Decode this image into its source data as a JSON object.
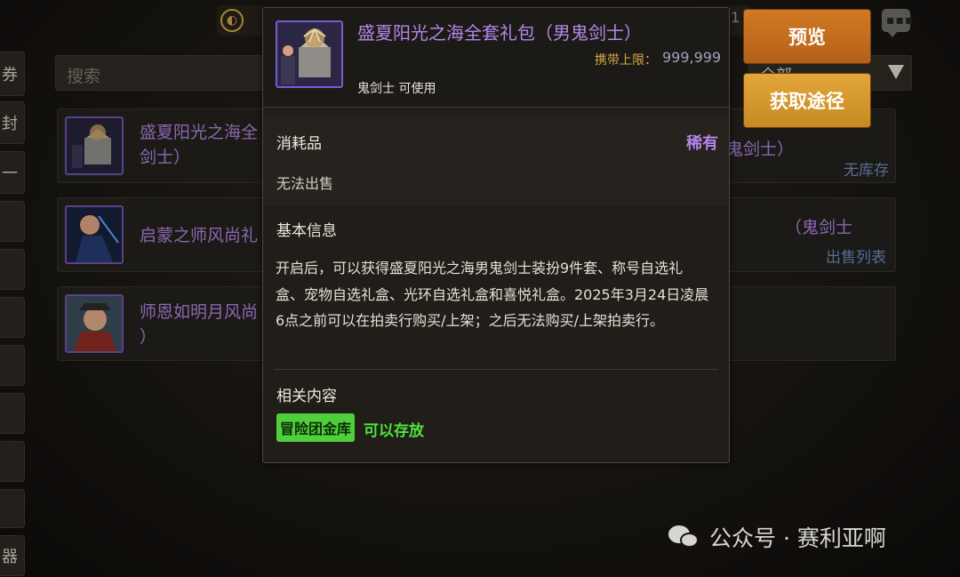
{
  "topbar": {
    "currency_text": "11"
  },
  "sidebar": {
    "tabs": [
      {
        "label": "券"
      },
      {
        "label": "封"
      },
      {
        "label": "一"
      },
      {
        "label": ""
      },
      {
        "label": ""
      },
      {
        "label": ""
      },
      {
        "label": ""
      },
      {
        "label": ""
      },
      {
        "label": ""
      },
      {
        "label": ""
      },
      {
        "label": "器"
      }
    ]
  },
  "search": {
    "placeholder": "搜索"
  },
  "filter": {
    "selected": "全部"
  },
  "buttons": {
    "preview": "预览",
    "source": "获取途径"
  },
  "list": {
    "items": [
      {
        "name": "盛夏阳光之海全套礼包（男鬼剑士）",
        "name_visible": "盛夏阳光之海全\n剑士）",
        "right_name": "鬼剑士）",
        "status": "无库存"
      },
      {
        "name": "启蒙之师风尚礼",
        "name_visible": "启蒙之师风尚礼",
        "right_name": "（鬼剑士",
        "status": "出售列表"
      },
      {
        "name": "师恩如明月风尚",
        "name_visible": "师恩如明月风尚\n）",
        "right_name": "",
        "status": ""
      }
    ]
  },
  "tooltip": {
    "title": "盛夏阳光之海全套礼包（男鬼剑士）",
    "carry_limit_label": "携带上限：",
    "carry_limit_value": "999,999",
    "usable_by": "鬼剑士 可使用",
    "category": "消耗品",
    "rarity": "稀有",
    "sell_status": "无法出售",
    "basic_info_title": "基本信息",
    "description": "开启后，可以获得盛夏阳光之海男鬼剑士装扮9件套、称号自选礼盒、宠物自选礼盒、光环自选礼盒和喜悦礼盒。2025年3月24日凌晨6点之前可以在拍卖行购买/上架；之后无法购买/上架拍卖行。",
    "related_title": "相关内容",
    "related_tag": "冒险团金库",
    "related_text": "可以存放"
  },
  "watermark": {
    "text": "公众号 · 赛利亚啊"
  },
  "colors": {
    "rare_purple": "#b486e8",
    "store_green": "#4fcf3b",
    "preview_orange": "#d07a24",
    "source_gold": "#e2a63a"
  }
}
